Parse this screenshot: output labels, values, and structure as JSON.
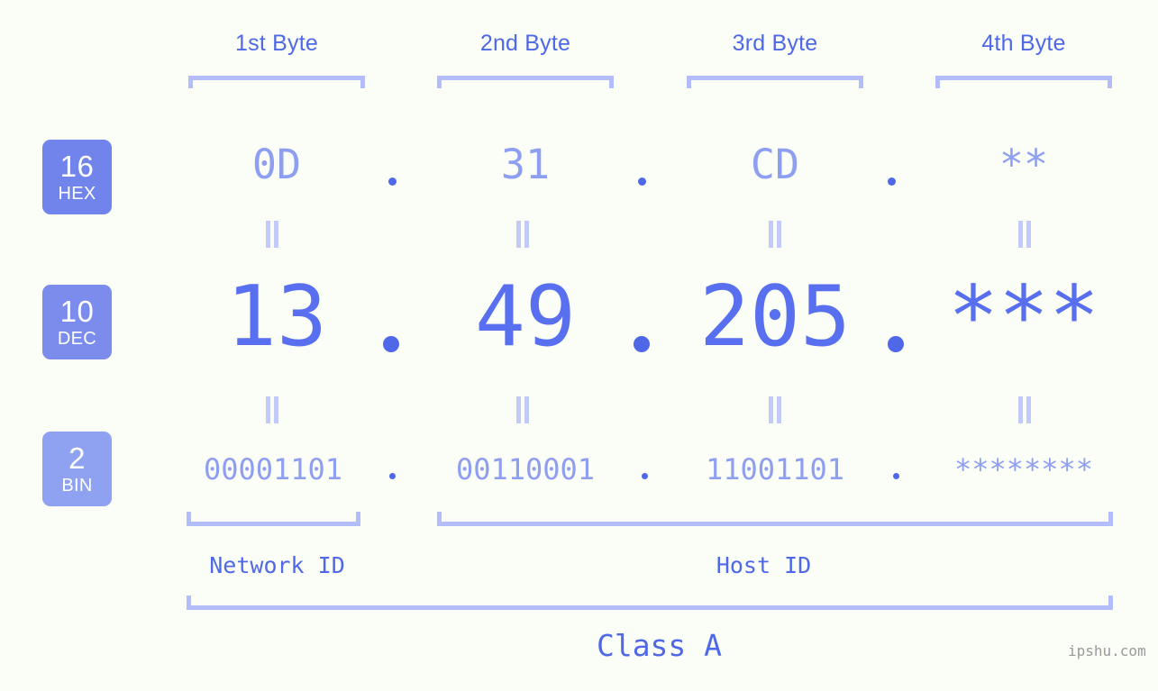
{
  "background_color": "#fbfdf7",
  "accent_colors": {
    "strong_blue": "#4f68e8",
    "mid_blue": "#5870ef",
    "light_blue": "#8e9ef0",
    "bracket_blue": "#b3bdfb",
    "badge_hex": "#7184ec",
    "badge_dec": "#7c8ced",
    "badge_bin": "#8fa2f2"
  },
  "byte_headers": [
    {
      "label": "1st Byte"
    },
    {
      "label": "2nd Byte"
    },
    {
      "label": "3rd Byte"
    },
    {
      "label": "4th Byte"
    }
  ],
  "bases": [
    {
      "number": "16",
      "name": "HEX"
    },
    {
      "number": "10",
      "name": "DEC"
    },
    {
      "number": "2",
      "name": "BIN"
    }
  ],
  "rows": {
    "hex": {
      "base": "16",
      "base_name": "HEX",
      "values": [
        "0D",
        "31",
        "CD",
        "**"
      ]
    },
    "dec": {
      "base": "10",
      "base_name": "DEC",
      "values": [
        "13",
        "49",
        "205",
        "***"
      ]
    },
    "bin": {
      "base": "2",
      "base_name": "BIN",
      "values": [
        "00001101",
        "00110001",
        "11001101",
        "********"
      ]
    }
  },
  "separator": ".",
  "equality_symbol": "=",
  "segments": {
    "network_id": "Network ID",
    "host_id": "Host ID",
    "class": "Class A"
  },
  "watermark": "ipshu.com"
}
